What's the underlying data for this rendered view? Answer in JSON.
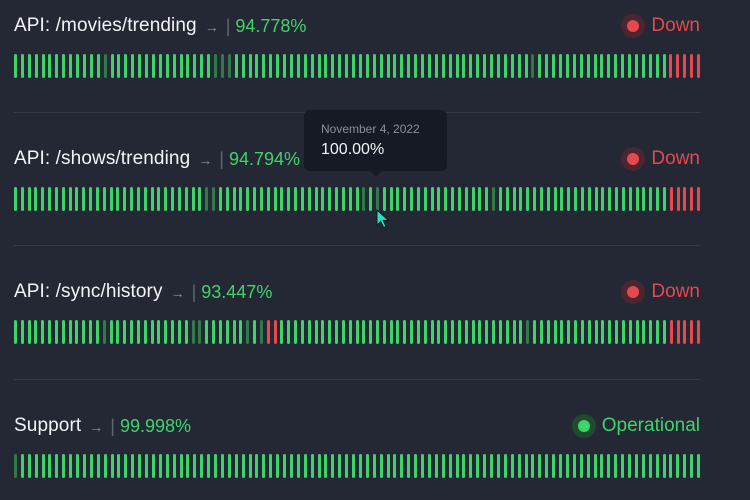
{
  "monitors": [
    {
      "name": "API: /movies/trending",
      "uptime": "94.778%",
      "status": "Down",
      "status_kind": "down",
      "bars": "gggggggggggggdgggggggggggggggdddgggggggggggggggggggggggggggggggggggggggggggdgggggggggggggggggggrrrrr"
    },
    {
      "name": "API: /shows/trending",
      "uptime": "94.794%",
      "status": "Down",
      "status_kind": "down",
      "bars": "ggggggggggggggggggggggggggggddgggggggggggggggggggggdgdggggggggggggggggdgggggggggggggggggggggggggrrrrr"
    },
    {
      "name": "API: /sync/history",
      "uptime": "93.447%",
      "status": "Down",
      "status_kind": "down",
      "bars": "gggggggggggggdggggggggggggddggggggdgdrrggggggggggggggggggggggggggggggggggggdggggggggggggggggggggrrrrr"
    },
    {
      "name": "Support",
      "uptime": "99.998%",
      "status": "Operational",
      "status_kind": "up",
      "bars": "dggggggggggggggggggggggggggggggggggggggggggggggggggggggggggggggggggggggggggggggggggggggggggggggggggg"
    }
  ],
  "tooltip": {
    "date": "November 4, 2022",
    "value": "100.00%"
  },
  "icons": {
    "arrow": "arrow-right-icon",
    "cursor": "mouse-pointer-icon"
  },
  "colors": {
    "background": "#232834",
    "up": "#3fd46a",
    "up_dim": "#2f7a48",
    "down": "#e5484d"
  }
}
